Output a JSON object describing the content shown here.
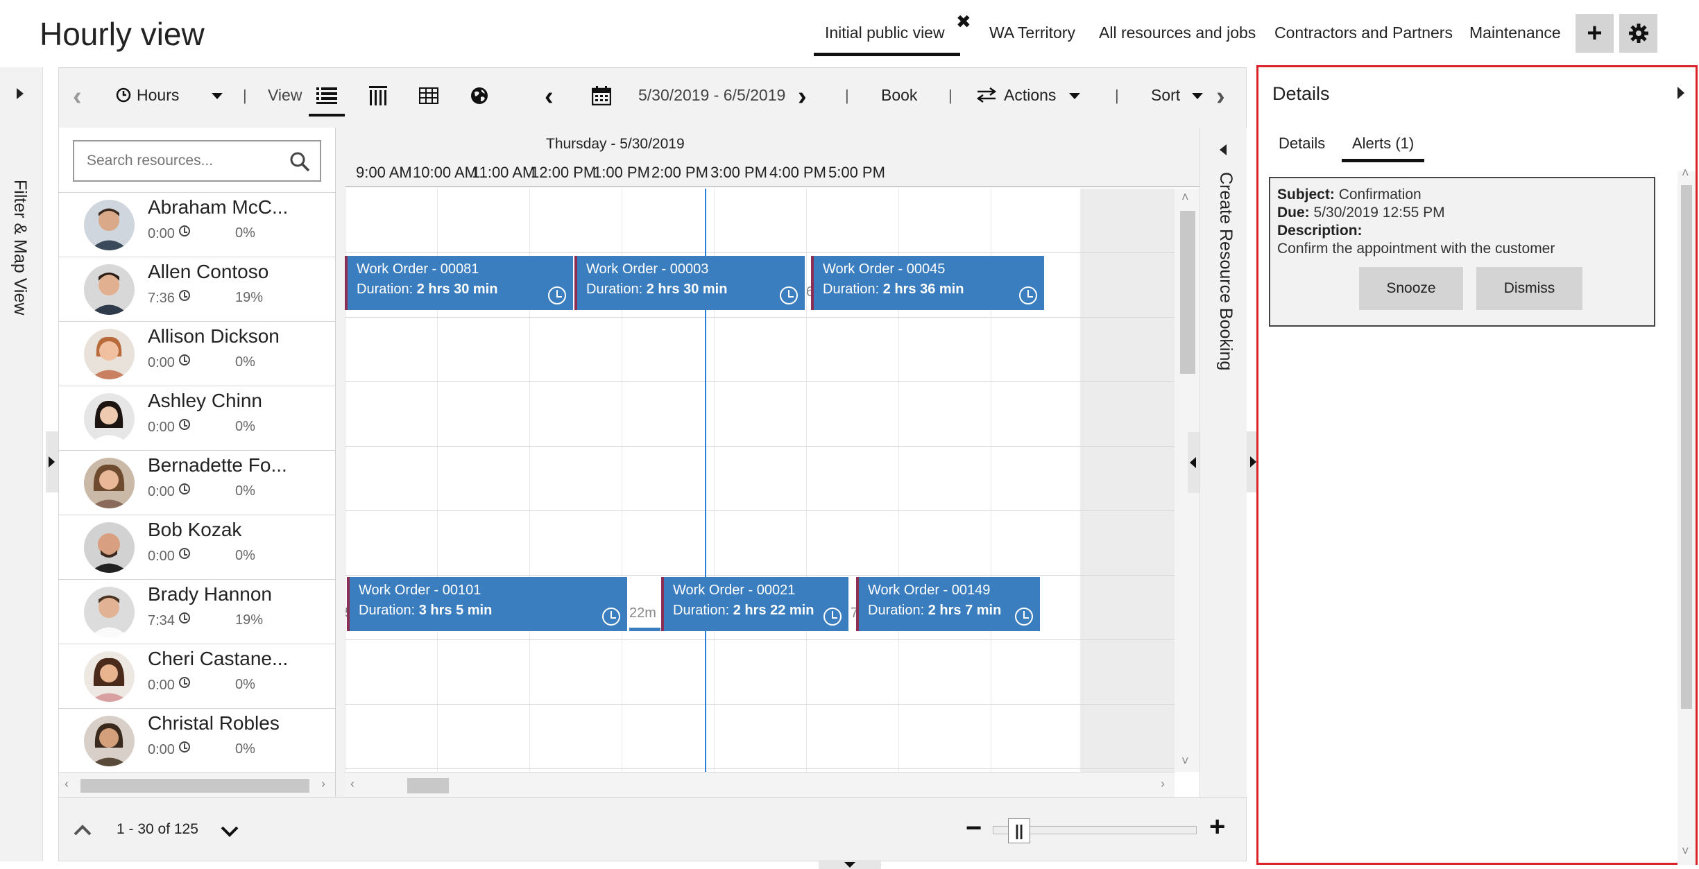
{
  "header": {
    "title": "Hourly view",
    "tabs": [
      {
        "label": "Initial public view",
        "active": true
      },
      {
        "label": "WA Territory"
      },
      {
        "label": "All resources and jobs"
      },
      {
        "label": "Contractors and Partners"
      },
      {
        "label": "Maintenance"
      }
    ],
    "close_glyph": "✖",
    "add_glyph": "+",
    "settings_icon": "gear-icon"
  },
  "filter_panel": {
    "label": "Filter & Map View"
  },
  "toolbar": {
    "hours_label": "Hours",
    "view_label": "View",
    "date_range": "5/30/2019 - 6/5/2019",
    "book_label": "Book",
    "actions_label": "Actions",
    "sort_label": "Sort",
    "separator": "|"
  },
  "search": {
    "placeholder": "Search resources..."
  },
  "resources": [
    {
      "name": "Abraham McC...",
      "hours": "0:00",
      "pct": "0%"
    },
    {
      "name": "Allen Contoso",
      "hours": "7:36",
      "pct": "19%"
    },
    {
      "name": "Allison Dickson",
      "hours": "0:00",
      "pct": "0%"
    },
    {
      "name": "Ashley Chinn",
      "hours": "0:00",
      "pct": "0%"
    },
    {
      "name": "Bernadette Fo...",
      "hours": "0:00",
      "pct": "0%"
    },
    {
      "name": "Bob Kozak",
      "hours": "0:00",
      "pct": "0%"
    },
    {
      "name": "Brady Hannon",
      "hours": "7:34",
      "pct": "19%"
    },
    {
      "name": "Cheri Castane...",
      "hours": "0:00",
      "pct": "0%"
    },
    {
      "name": "Christal Robles",
      "hours": "0:00",
      "pct": "0%"
    }
  ],
  "schedule": {
    "date_label": "Thursday - 5/30/2019",
    "hours": [
      "9:00 AM",
      "10:00 AM",
      "11:00 AM",
      "12:00 PM",
      "1:00 PM",
      "2:00 PM",
      "3:00 PM",
      "4:00 PM",
      "5:00 PM"
    ],
    "duration_prefix": "Duration: ",
    "bookings": [
      {
        "title": "Work Order - 00081",
        "duration": "2 hrs 30 min"
      },
      {
        "title": "Work Order - 00003",
        "duration": "2 hrs 30 min"
      },
      {
        "title": "Work Order - 00045",
        "duration": "2 hrs 36 min"
      },
      {
        "title": "Work Order - 00101",
        "duration": "3 hrs 5 min"
      },
      {
        "title": "Work Order - 00021",
        "duration": "2 hrs 22 min"
      },
      {
        "title": "Work Order - 00149",
        "duration": "2 hrs 7 min"
      }
    ],
    "travel_labels": [
      "6",
      "5",
      "22m",
      "7"
    ]
  },
  "create_booking": {
    "label": "Create Resource Booking"
  },
  "footer": {
    "page_info": "1 - 30 of 125",
    "zoom_minus": "−",
    "zoom_plus": "+",
    "zoom_handle": "||"
  },
  "details": {
    "title": "Details",
    "tabs": [
      {
        "label": "Details"
      },
      {
        "label": "Alerts (1)",
        "active": true
      }
    ],
    "alert": {
      "subject_label": "Subject:",
      "subject": "Confirmation",
      "due_label": "Due:",
      "due": "5/30/2019 12:55 PM",
      "description_label": "Description:",
      "description": "Confirm the appointment with the customer",
      "snooze_label": "Snooze",
      "dismiss_label": "Dismiss"
    },
    "accent_color": "#d9222a"
  },
  "colors": {
    "booking": "#3a7ebf",
    "booking_accent": "#8b2f55",
    "now_line": "#2a7fd6"
  }
}
